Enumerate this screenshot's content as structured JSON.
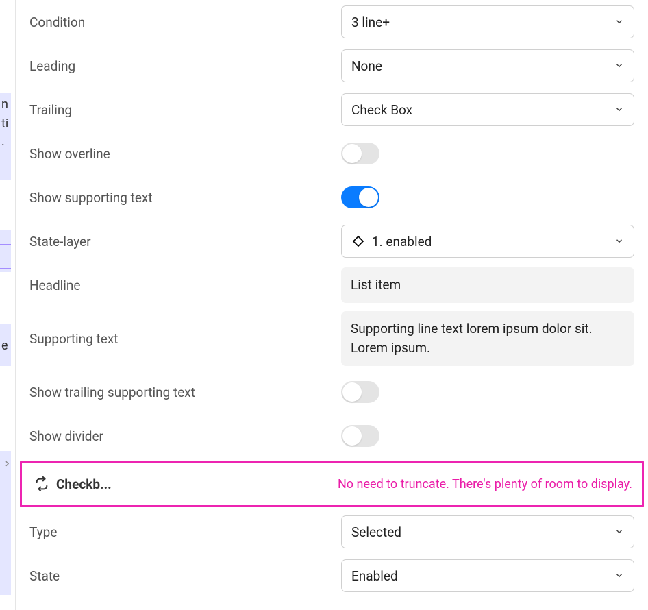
{
  "leftEdge": {
    "cut1": "n",
    "cut2": "ti",
    "cut3": ".",
    "cut4": "",
    "cut5": "e"
  },
  "rows": {
    "condition": {
      "label": "Condition",
      "value": "3 line+"
    },
    "leading": {
      "label": "Leading",
      "value": "None"
    },
    "trailing": {
      "label": "Trailing",
      "value": "Check Box"
    },
    "showOverline": {
      "label": "Show overline",
      "on": false
    },
    "showSupportingText": {
      "label": "Show supporting text",
      "on": true
    },
    "stateLayer": {
      "label": "State-layer",
      "value": "1. enabled"
    },
    "headline": {
      "label": "Headline",
      "value": "List item"
    },
    "supportingText": {
      "label": "Supporting text",
      "value": "Supporting line text lorem ipsum dolor sit. Lorem ipsum."
    },
    "showTrailingSupportingText": {
      "label": "Show trailing supporting text",
      "on": false
    },
    "showDivider": {
      "label": "Show divider",
      "on": false
    },
    "type": {
      "label": "Type",
      "value": "Selected"
    },
    "state": {
      "label": "State",
      "value": "Enabled"
    }
  },
  "section": {
    "title": "Checkb...",
    "annotation": "No need to truncate. There's plenty of room to display."
  }
}
